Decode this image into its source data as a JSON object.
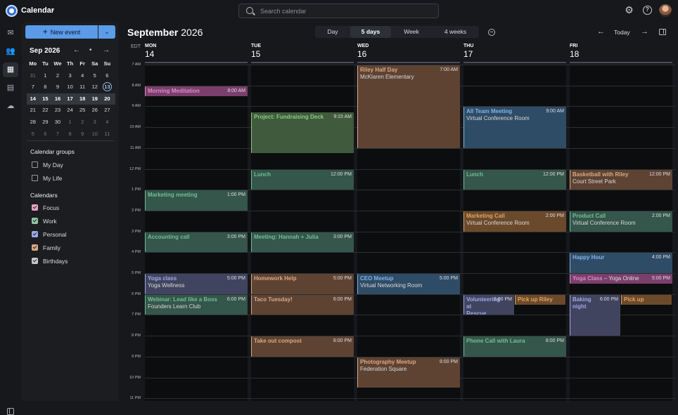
{
  "app": {
    "title": "Calendar",
    "search_placeholder": "Search calendar"
  },
  "icons": {
    "settings": "gear-icon",
    "help": "help-icon"
  },
  "sidebar": {
    "new_event_label": "New event",
    "mini_calendar": {
      "title": "Sep 2026",
      "weekdays": [
        "Mo",
        "Tu",
        "We",
        "Th",
        "Fr",
        "Sa",
        "Su"
      ],
      "weeks": [
        [
          "31",
          "1",
          "2",
          "3",
          "4",
          "5",
          "6"
        ],
        [
          "7",
          "8",
          "9",
          "10",
          "11",
          "12",
          "13"
        ],
        [
          "14",
          "15",
          "16",
          "17",
          "18",
          "19",
          "20"
        ],
        [
          "21",
          "22",
          "23",
          "24",
          "25",
          "26",
          "27"
        ],
        [
          "28",
          "29",
          "30",
          "1",
          "2",
          "3",
          "4"
        ],
        [
          "5",
          "6",
          "7",
          "8",
          "9",
          "10",
          "11"
        ]
      ],
      "today": "13",
      "selected_week_index": 2
    },
    "groups_title": "Calendar groups",
    "groups": [
      {
        "label": "My Day"
      },
      {
        "label": "My Life"
      }
    ],
    "calendars_title": "Calendars",
    "calendars": [
      {
        "label": "Focus",
        "color": "#e8a2c4"
      },
      {
        "label": "Work",
        "color": "#8fc6a6"
      },
      {
        "label": "Personal",
        "color": "#9ea8e6"
      },
      {
        "label": "Family",
        "color": "#d9a882"
      },
      {
        "label": "Birthdays",
        "color": "#c8c8c8"
      }
    ]
  },
  "main": {
    "month": "September",
    "year": "2026",
    "views": [
      "Day",
      "5 days",
      "Week",
      "4 weeks"
    ],
    "active_view": "5 days",
    "today_label": "Today",
    "timezone": "EDT",
    "days": [
      {
        "name": "MON",
        "date": "14"
      },
      {
        "name": "TUE",
        "date": "15"
      },
      {
        "name": "WED",
        "date": "16"
      },
      {
        "name": "THU",
        "date": "17"
      },
      {
        "name": "FRI",
        "date": "18"
      }
    ],
    "hours": [
      "7 AM",
      "8 AM",
      "9 AM",
      "10 AM",
      "11 AM",
      "12 PM",
      "1 PM",
      "2 PM",
      "3 PM",
      "4 PM",
      "5 PM",
      "6 PM",
      "7 PM",
      "8 PM",
      "9 PM",
      "10 PM",
      "11 PM"
    ],
    "events": [
      {
        "day": 0,
        "start": 8.0,
        "end": 8.5,
        "title": "Morning Meditation",
        "time": "8:00 AM",
        "sub": "",
        "color": "#7a3f6c",
        "border": "#d98bc7"
      },
      {
        "day": 0,
        "start": 13.0,
        "end": 14.0,
        "title": "Marketing meeting",
        "time": "1:00 PM",
        "sub": "",
        "color": "#35564a",
        "border": "#6fbf98"
      },
      {
        "day": 0,
        "start": 15.0,
        "end": 16.0,
        "title": "Accounting call",
        "time": "3:00 PM",
        "sub": "",
        "color": "#35564a",
        "border": "#6fbf98"
      },
      {
        "day": 0,
        "start": 17.0,
        "end": 18.0,
        "title": "Yoga class",
        "time": "5:00 PM",
        "sub": "Yoga Wellness",
        "color": "#41445f",
        "border": "#9ea8e6"
      },
      {
        "day": 0,
        "start": 18.0,
        "end": 19.0,
        "title": "Webinar: Lead like a Boss",
        "time": "6:00 PM",
        "sub": "Founders Learn Club",
        "color": "#35564a",
        "border": "#6fbf98"
      },
      {
        "day": 1,
        "start": 9.25,
        "end": 11.25,
        "title": "Project: Fundraising Deck",
        "time": "9:15 AM",
        "sub": "",
        "color": "#3f5a3c",
        "border": "#8fc67f"
      },
      {
        "day": 1,
        "start": 12.0,
        "end": 13.0,
        "title": "Lunch",
        "time": "12:00 PM",
        "sub": "",
        "color": "#35564a",
        "border": "#6fbf98"
      },
      {
        "day": 1,
        "start": 15.0,
        "end": 16.0,
        "title": "Meeting: Hannah + Julia",
        "time": "3:00 PM",
        "sub": "",
        "color": "#35564a",
        "border": "#6fbf98"
      },
      {
        "day": 1,
        "start": 17.0,
        "end": 18.0,
        "title": "Homework Help",
        "time": "5:00 PM",
        "sub": "",
        "color": "#5e4333",
        "border": "#d9a882"
      },
      {
        "day": 1,
        "start": 18.0,
        "end": 19.0,
        "title": "Taco Tuesday!",
        "time": "6:00 PM",
        "sub": "",
        "color": "#5e4333",
        "border": "#d9a882"
      },
      {
        "day": 1,
        "start": 20.0,
        "end": 21.0,
        "title": "Take out compost",
        "time": "8:00 PM",
        "sub": "",
        "color": "#5e4333",
        "border": "#d9a882"
      },
      {
        "day": 2,
        "start": 7.0,
        "end": 11.0,
        "title": "Riley Half Day",
        "time": "7:00 AM",
        "sub": "McKlaren Elementary",
        "color": "#5e4333",
        "border": "#d9a882"
      },
      {
        "day": 2,
        "start": 17.0,
        "end": 18.0,
        "title": "CEO Meetup",
        "time": "5:00 PM",
        "sub": "Virtual Networking Room",
        "color": "#2f4c66",
        "border": "#7fb4e6"
      },
      {
        "day": 2,
        "start": 21.0,
        "end": 22.5,
        "title": "Photography Meetup",
        "time": "9:00 PM",
        "sub": "Federation Square",
        "color": "#5e4333",
        "border": "#d9a882"
      },
      {
        "day": 3,
        "start": 9.0,
        "end": 11.0,
        "title": "All Team Meeting",
        "time": "9:00 AM",
        "sub": "Virtual Conference Room",
        "color": "#2f4c66",
        "border": "#7fb4e6"
      },
      {
        "day": 3,
        "start": 12.0,
        "end": 13.0,
        "title": "Lunch",
        "time": "12:00 PM",
        "sub": "",
        "color": "#35564a",
        "border": "#6fbf98"
      },
      {
        "day": 3,
        "start": 14.0,
        "end": 15.0,
        "title": "Marketing Call",
        "time": "2:00 PM",
        "sub": "Virtual Conference Room",
        "color": "#6b4a2c",
        "border": "#e0a35c"
      },
      {
        "day": 3,
        "start": 18.0,
        "end": 19.0,
        "title": "Volunteering at Rescue",
        "time": "6:00 PM",
        "sub": "",
        "color": "#41445f",
        "border": "#9ea8e6",
        "lane": 0,
        "lanes": 2
      },
      {
        "day": 3,
        "start": 18.0,
        "end": 18.5,
        "title": "Pick up Riley",
        "time": "6:00 PM",
        "sub": "",
        "color": "#6b4a2c",
        "border": "#e0a35c",
        "lane": 1,
        "lanes": 2
      },
      {
        "day": 3,
        "start": 20.0,
        "end": 21.0,
        "title": "Phone Call with Laura",
        "time": "8:00 PM",
        "sub": "",
        "color": "#35564a",
        "border": "#6fbf98"
      },
      {
        "day": 4,
        "start": 12.0,
        "end": 13.0,
        "title": "Basketball with Riley",
        "time": "12:00 PM",
        "sub": "Court Street Park",
        "color": "#5e4333",
        "border": "#d9a882"
      },
      {
        "day": 4,
        "start": 14.0,
        "end": 15.0,
        "title": "Product Call",
        "time": "2:00 PM",
        "sub": "Virtual Conference Room",
        "color": "#35564a",
        "border": "#6fbf98"
      },
      {
        "day": 4,
        "start": 16.0,
        "end": 17.0,
        "title": "Happy Hour",
        "time": "4:00 PM",
        "sub": "",
        "color": "#2f4c66",
        "border": "#7fb4e6"
      },
      {
        "day": 4,
        "start": 17.0,
        "end": 17.5,
        "title": "Yoga Class",
        "time": "5:00 PM",
        "sub": "– Yoga Online",
        "color": "#7a3f6c",
        "border": "#d98bc7",
        "inline_sub": true
      },
      {
        "day": 4,
        "start": 18.0,
        "end": 20.0,
        "title": "Baking night",
        "time": "6:00 PM",
        "sub": "",
        "color": "#41445f",
        "border": "#9ea8e6",
        "lane": 0,
        "lanes": 2
      },
      {
        "day": 4,
        "start": 18.0,
        "end": 18.5,
        "title": "Pick up",
        "time": "6:00 PM",
        "sub": "",
        "color": "#6b4a2c",
        "border": "#e0a35c",
        "lane": 1,
        "lanes": 2
      }
    ]
  }
}
